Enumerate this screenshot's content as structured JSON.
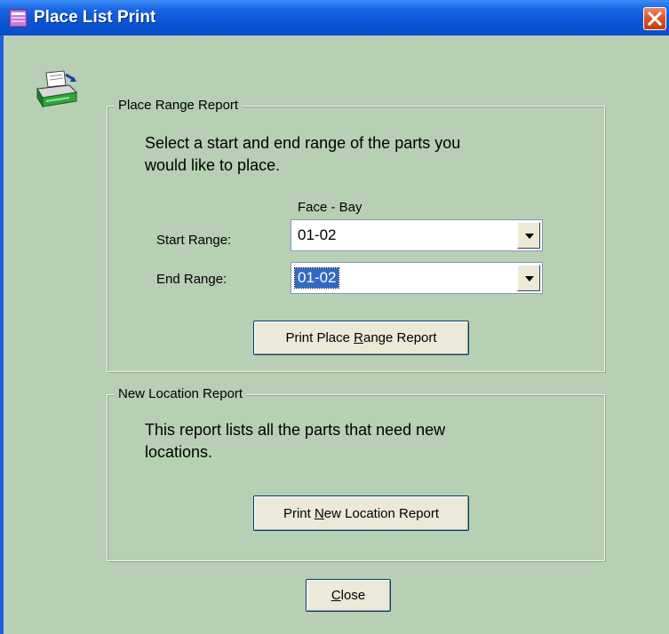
{
  "window": {
    "title": "Place List Print"
  },
  "range_group": {
    "legend": "Place Range Report",
    "description_line1": "Select a start and end range of the parts you",
    "description_line2": "would like to place.",
    "column_header": "Face - Bay",
    "start_label": "Start Range:",
    "start_value": "01-02",
    "end_label": "End Range:",
    "end_value": "01-02",
    "print_button": {
      "pre": "Print Place ",
      "accel": "R",
      "post": "ange Report"
    }
  },
  "location_group": {
    "legend": "New Location Report",
    "description_line1": "This report lists all the parts that need new",
    "description_line2": "locations.",
    "print_button": {
      "pre": "Print ",
      "accel": "N",
      "post": "ew Location Report"
    }
  },
  "close_button": {
    "pre": "",
    "accel": "C",
    "post": "lose"
  },
  "icons": {
    "title": "form-icon",
    "printer": "printer-icon",
    "close": "close-icon"
  },
  "colors": {
    "titlebar": "#0a55d6",
    "client": "#b7cfb3",
    "close": "#d9542a"
  }
}
